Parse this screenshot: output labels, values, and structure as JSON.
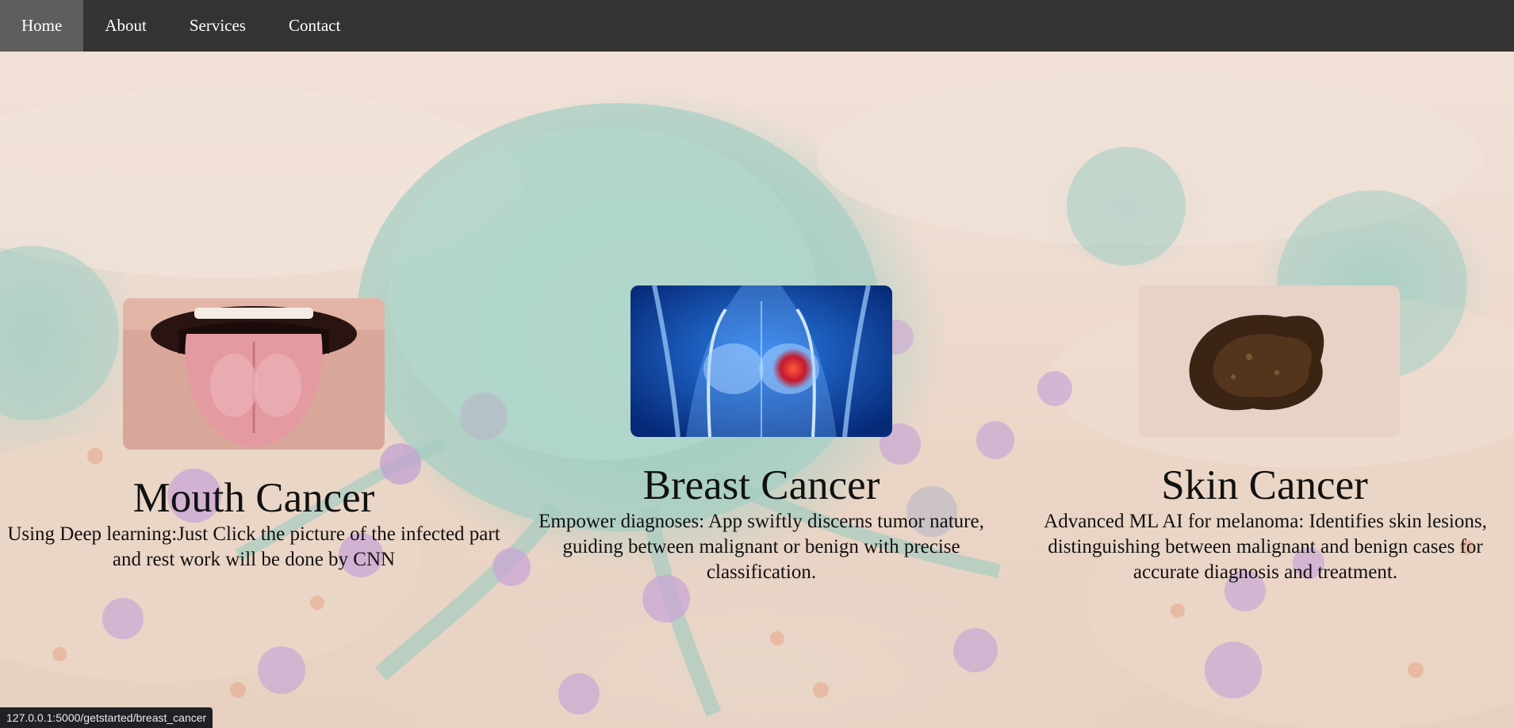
{
  "nav": {
    "items": [
      {
        "label": "Home",
        "active": true
      },
      {
        "label": "About",
        "active": false
      },
      {
        "label": "Services",
        "active": false
      },
      {
        "label": "Contact",
        "active": false
      }
    ]
  },
  "cards": {
    "mouth": {
      "title": "Mouth Cancer",
      "description": "Using Deep learning:Just Click the picture of the infected part and rest work will be done by CNN",
      "image_icon": "tongue-image"
    },
    "breast": {
      "title": "Breast Cancer",
      "description": "Empower diagnoses: App swiftly discerns tumor nature, guiding between malignant or benign with precise classification.",
      "image_icon": "breast-xray-image"
    },
    "skin": {
      "title": "Skin Cancer",
      "description": "Advanced ML AI for melanoma: Identifies skin lesions, distinguishing between malignant and benign cases for accurate diagnosis and treatment.",
      "image_icon": "melanoma-image"
    }
  },
  "status_bar": {
    "url": "127.0.0.1:5000/getstarted/breast_cancer"
  },
  "colors": {
    "nav_bg": "#333333",
    "nav_active_bg": "#5e5e5e",
    "nav_text": "#ffffff",
    "status_bg": "#202124"
  }
}
